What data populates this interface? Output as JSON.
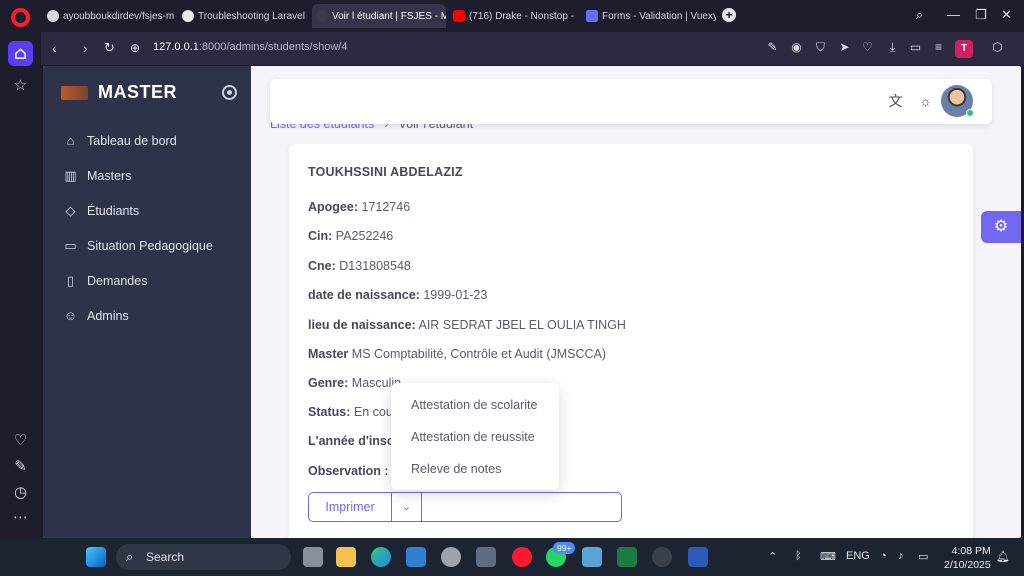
{
  "browser": {
    "tabs": [
      {
        "label": "ayoubboukdirdev/fsjes-m",
        "color": "#d8d8e2"
      },
      {
        "label": "Troubleshooting Laravel S",
        "color": "#e8e8ee"
      },
      {
        "label": "Voir l étudiant | FSJES - M",
        "color": "#8b4dff"
      },
      {
        "label": "(716) Drake - Nonstop - Y",
        "color": "#ff0000"
      },
      {
        "label": "Forms - Validation | Vuexy",
        "color": "#7367f0"
      }
    ],
    "url_host": "127.0.0.1",
    "url_path": ":8000/admins/students/show/4"
  },
  "sidebar": {
    "brand": "MASTER",
    "items": [
      {
        "label": "Tableau de bord",
        "icon": "home-icon"
      },
      {
        "label": "Masters",
        "icon": "books-icon"
      },
      {
        "label": "Étudiants",
        "icon": "school-icon"
      },
      {
        "label": "Situation Pedagogique",
        "icon": "screen-icon"
      },
      {
        "label": "Demandes",
        "icon": "file-icon"
      },
      {
        "label": "Admins",
        "icon": "users-icon"
      }
    ]
  },
  "breadcrumb": {
    "parent": "Liste des étudiants",
    "current": "Voir l'étudiant"
  },
  "student": {
    "name": "TOUKHSSINI ABDELAZIZ",
    "fields": [
      {
        "label": "Apogee:",
        "value": "1712746"
      },
      {
        "label": "Cin:",
        "value": "PA252246"
      },
      {
        "label": "Cne:",
        "value": "D131808548"
      },
      {
        "label": "date de naissance:",
        "value": "1999-01-23"
      },
      {
        "label": "lieu de naissance:",
        "value": "AIR SEDRAT JBEL EL OULIA TINGH"
      },
      {
        "label": "Master",
        "value": "MS Comptabilité, Contrôle et Audit (JMSCCA)"
      },
      {
        "label": "Genre:",
        "value": "Masculin"
      },
      {
        "label": "Status:",
        "value": "En cours"
      },
      {
        "label": "L'année d'inscr",
        "value": ""
      },
      {
        "label": "Observation :",
        "value": ""
      }
    ]
  },
  "print": {
    "label": "Imprimer",
    "options": [
      "Attestation de scolarite",
      "Attestation de reussite",
      "Releve de notes"
    ]
  },
  "taskbar": {
    "search_label": "Search",
    "badge": "99+",
    "lang": "ENG",
    "time": "4:08 PM",
    "date": "2/10/2025"
  }
}
